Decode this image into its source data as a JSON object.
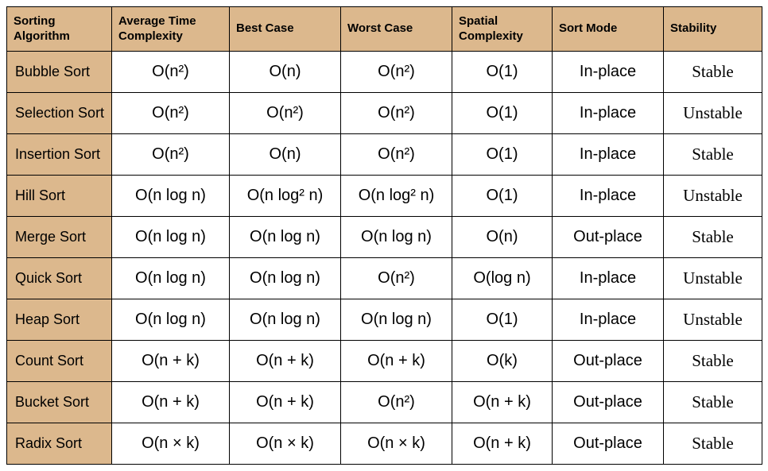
{
  "chart_data": {
    "type": "table",
    "columns": [
      "Sorting Algorithm",
      "Average Time Complexity",
      "Best Case",
      "Worst Case",
      "Spatial Complexity",
      "Sort Mode",
      "Stability"
    ],
    "rows": [
      {
        "algo": "Bubble Sort",
        "avg": "O(n²)",
        "best": "O(n)",
        "worst": "O(n²)",
        "space": "O(1)",
        "mode": "In-place",
        "stab": "Stable"
      },
      {
        "algo": "Selection Sort",
        "avg": "O(n²)",
        "best": "O(n²)",
        "worst": "O(n²)",
        "space": "O(1)",
        "mode": "In-place",
        "stab": "Unstable"
      },
      {
        "algo": "Insertion Sort",
        "avg": "O(n²)",
        "best": "O(n)",
        "worst": "O(n²)",
        "space": "O(1)",
        "mode": "In-place",
        "stab": "Stable"
      },
      {
        "algo": "Hill Sort",
        "avg": "O(n log n)",
        "best": "O(n log² n)",
        "worst": "O(n log² n)",
        "space": "O(1)",
        "mode": "In-place",
        "stab": "Unstable"
      },
      {
        "algo": "Merge Sort",
        "avg": "O(n log n)",
        "best": "O(n log n)",
        "worst": "O(n log n)",
        "space": "O(n)",
        "mode": "Out-place",
        "stab": "Stable"
      },
      {
        "algo": "Quick Sort",
        "avg": "O(n log n)",
        "best": "O(n log n)",
        "worst": "O(n²)",
        "space": "O(log n)",
        "mode": "In-place",
        "stab": "Unstable"
      },
      {
        "algo": "Heap  Sort",
        "avg": "O(n log n)",
        "best": "O(n log n)",
        "worst": "O(n log n)",
        "space": "O(1)",
        "mode": "In-place",
        "stab": "Unstable"
      },
      {
        "algo": "Count Sort",
        "avg": "O(n + k)",
        "best": "O(n + k)",
        "worst": "O(n + k)",
        "space": "O(k)",
        "mode": "Out-place",
        "stab": "Stable"
      },
      {
        "algo": "Bucket Sort",
        "avg": "O(n + k)",
        "best": "O(n + k)",
        "worst": "O(n²)",
        "space": "O(n + k)",
        "mode": "Out-place",
        "stab": "Stable"
      },
      {
        "algo": "Radix Sort",
        "avg": "O(n × k)",
        "best": "O(n × k)",
        "worst": "O(n × k)",
        "space": "O(n + k)",
        "mode": "Out-place",
        "stab": "Stable"
      }
    ]
  }
}
